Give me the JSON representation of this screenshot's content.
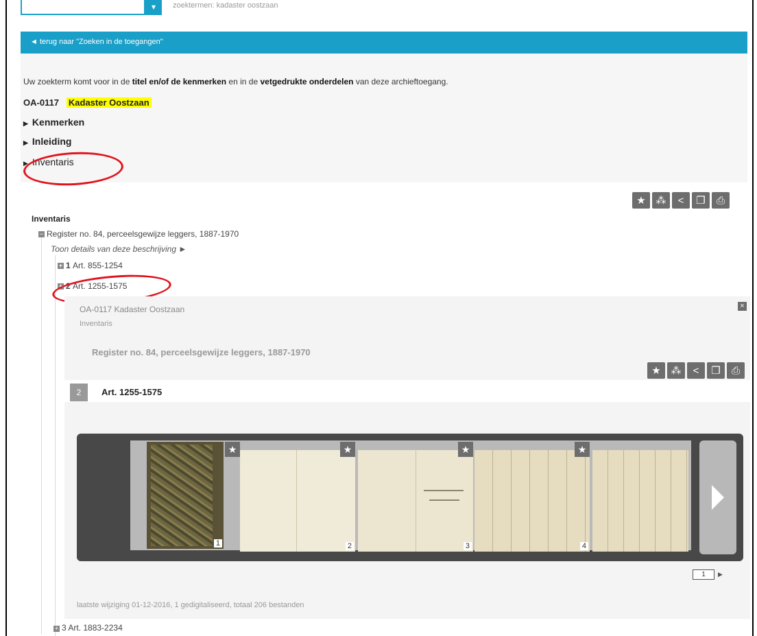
{
  "top": {
    "search_placeholder": "",
    "search_button_icon": "chevron-down-icon",
    "faint_text": "zoektermen: kadaster oostzaan"
  },
  "back_link": "◄ terug naar \"Zoeken in de toegangen\"",
  "intro": {
    "p1": "Uw zoekterm komt voor in de ",
    "b1": "titel en/of de kenmerken",
    "p2": " en in de ",
    "b2": "vetgedrukte onderdelen",
    "p3": " van deze archieftoegang."
  },
  "archive": {
    "code": "OA-0117",
    "title": "Kadaster Oostzaan"
  },
  "accordion": [
    {
      "label": "Kenmerken"
    },
    {
      "label": "Inleiding"
    },
    {
      "label": "Inventaris"
    }
  ],
  "toolbar_icons": [
    "star-icon",
    "network-icon",
    "share-icon",
    "copy-icon",
    "print-icon"
  ],
  "inventory": {
    "heading": "Inventaris",
    "register": "Register no. 84, perceelsgewijze leggers, 1887-1970",
    "detail_link": "Toon details van deze beschrijving ►",
    "items": [
      {
        "num": "1",
        "label": "Art. 855-1254"
      },
      {
        "num": "2",
        "label": "Art. 1255-1575"
      },
      {
        "num": "3",
        "label": "Art. 1883-2234"
      }
    ]
  },
  "detail": {
    "code_title": "OA-0117 Kadaster Oostzaan",
    "sub": "Inventaris",
    "register": "Register no. 84, perceelsgewijze leggers, 1887-1970",
    "num": "2",
    "title": "Art. 1255-1575",
    "thumbnails": [
      "1",
      "2",
      "3",
      "4"
    ],
    "page_input": "1",
    "footer": "laatste wijziging 01-12-2016,  1 gedigitaliseerd, totaal 206 bestanden"
  },
  "colors": {
    "accent": "#1aa0c8",
    "highlight": "#ffff00",
    "annotation": "#e0141e"
  }
}
